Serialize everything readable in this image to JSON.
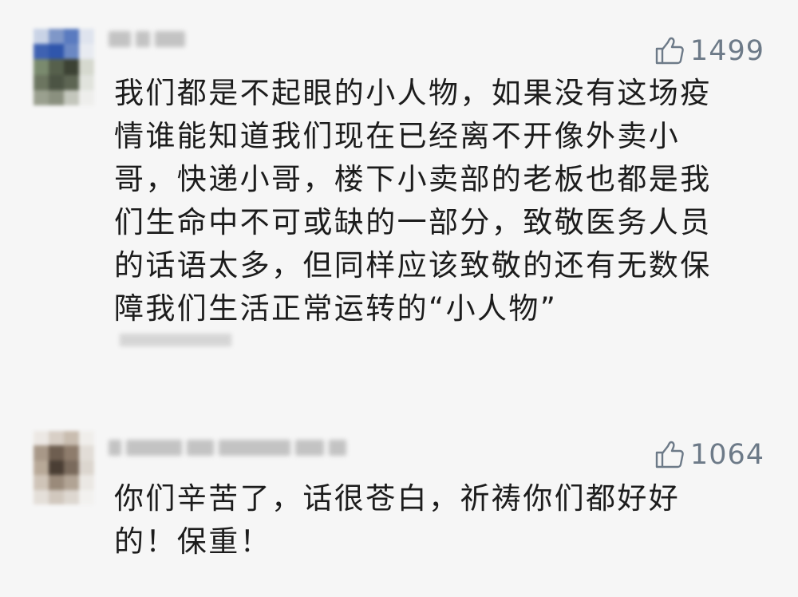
{
  "comments": [
    {
      "likes": "1499",
      "text": "我们都是不起眼的小人物，如果没有这场疫\n情谁能知道我们现在已经离不开像外卖小\n哥，快递小哥，楼下小卖部的老板也都是我\n们生命中不可或缺的一部分，致敬医务人员\n的话语太多，但同样应该致敬的还有无数保\n障我们生活正常运转的“小人物”"
    },
    {
      "likes": "1064",
      "text": "你们辛苦了，话很苍白，祈祷你们都好好\n的！保重！"
    }
  ],
  "icons": {
    "like": "thumbs-up-icon",
    "avatar": "avatar-pixelated"
  },
  "colors": {
    "background": "#f6f6f6",
    "like_count": "#6d7a88",
    "text": "#1c1c1c"
  }
}
